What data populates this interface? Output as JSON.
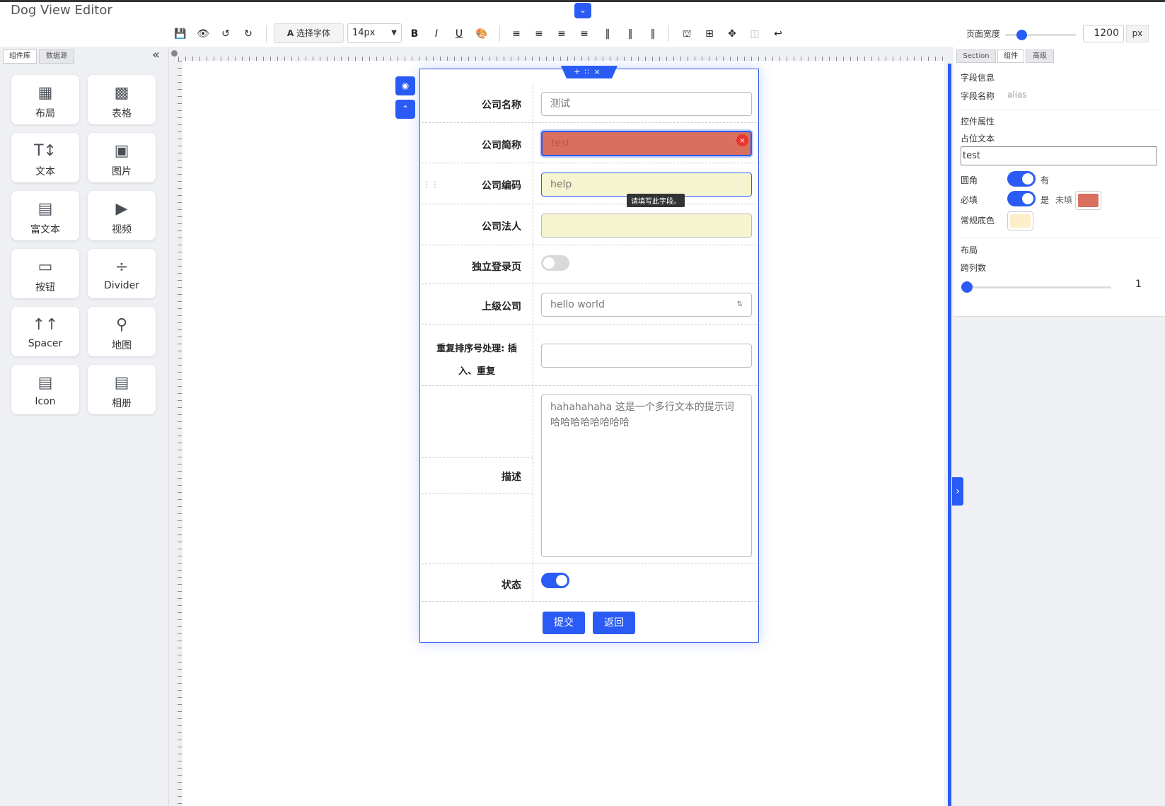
{
  "app": {
    "title": "Dog View Editor"
  },
  "toolbar": {
    "font_button": "选择字体",
    "font_size": "14px"
  },
  "page_width": {
    "label": "页面宽度",
    "value": "1200",
    "unit": "px"
  },
  "left_panel": {
    "tabs": [
      "组件库",
      "数据源"
    ],
    "components": [
      {
        "label": "布局",
        "icon": "layout-grid-icon"
      },
      {
        "label": "表格",
        "icon": "table-icon"
      },
      {
        "label": "文本",
        "icon": "text-icon"
      },
      {
        "label": "图片",
        "icon": "image-icon"
      },
      {
        "label": "富文本",
        "icon": "rich-text-icon"
      },
      {
        "label": "视频",
        "icon": "video-icon"
      },
      {
        "label": "按钮",
        "icon": "button-icon"
      },
      {
        "label": "Divider",
        "icon": "divider-icon"
      },
      {
        "label": "Spacer",
        "icon": "spacer-icon"
      },
      {
        "label": "地图",
        "icon": "map-pin-icon"
      },
      {
        "label": "Icon",
        "icon": "map-icon"
      },
      {
        "label": "相册",
        "icon": "album-icon"
      }
    ]
  },
  "form": {
    "fields": {
      "company_name": {
        "label": "公司名称",
        "value": "测试"
      },
      "company_short": {
        "label": "公司简称",
        "value": "test"
      },
      "company_code": {
        "label": "公司编码",
        "value": "help",
        "tooltip": "请填写此字段。"
      },
      "legal_person": {
        "label": "公司法人",
        "value": ""
      },
      "standalone_login": {
        "label": "独立登录页",
        "on": false
      },
      "parent_company": {
        "label": "上级公司",
        "value": "hello world"
      },
      "dup_sort": {
        "label_line1": "重复排序号处理: 插",
        "label_line2": "入、重复",
        "value": ""
      },
      "description": {
        "label": "描述",
        "placeholder": "hahahahaha 这是一个多行文本的提示词 哈哈哈哈哈哈哈哈"
      },
      "status": {
        "label": "状态",
        "on": true
      }
    },
    "submit": "提交",
    "back": "返回"
  },
  "right_panel": {
    "tabs": [
      "Section",
      "组件",
      "高级"
    ],
    "field_info_title": "字段信息",
    "field_name_label": "字段名称",
    "field_name_value": "alias",
    "control_props_title": "控件属性",
    "placeholder_label": "占位文本",
    "placeholder_value": "test",
    "rounded_label": "圆角",
    "rounded_value": "有",
    "required_label": "必填",
    "required_value": "是",
    "required_empty_label": "未填",
    "bg_label": "常规底色",
    "layout_title": "布局",
    "colspan_label": "跨列数",
    "colspan_value": "1"
  },
  "colors": {
    "accent": "#2a5cf5",
    "error_fill": "#d9705f",
    "warn_fill": "#f5f3d0",
    "required_empty_color": "#d9705f",
    "normal_bg_color": "#fdeec8"
  }
}
